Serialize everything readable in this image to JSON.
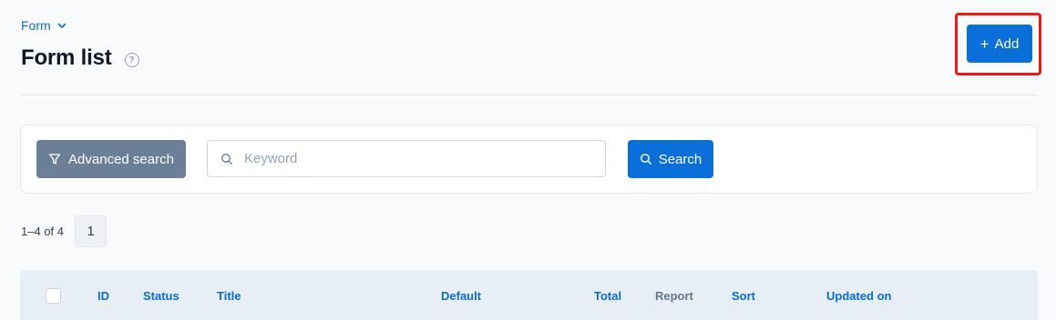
{
  "breadcrumb": {
    "label": "Form",
    "icon": "chevron-down-icon"
  },
  "page": {
    "title": "Form list",
    "help_icon": "help-circle-icon"
  },
  "toolbar": {
    "add_label": "Add",
    "add_icon": "plus-icon"
  },
  "search": {
    "advanced_label": "Advanced search",
    "advanced_icon": "filter-icon",
    "keyword_placeholder": "Keyword",
    "keyword_value": "",
    "search_label": "Search",
    "search_icon": "search-icon"
  },
  "pagination": {
    "range": "1–4 of 4",
    "pages": [
      "1"
    ]
  },
  "table": {
    "columns": [
      "ID",
      "Status",
      "Title",
      "Default",
      "Total",
      "Report",
      "Sort",
      "Updated on"
    ]
  },
  "colors": {
    "accent": "#0b6fd9",
    "highlight": "#e11d1d",
    "advanced_button": "#6b7f97"
  }
}
